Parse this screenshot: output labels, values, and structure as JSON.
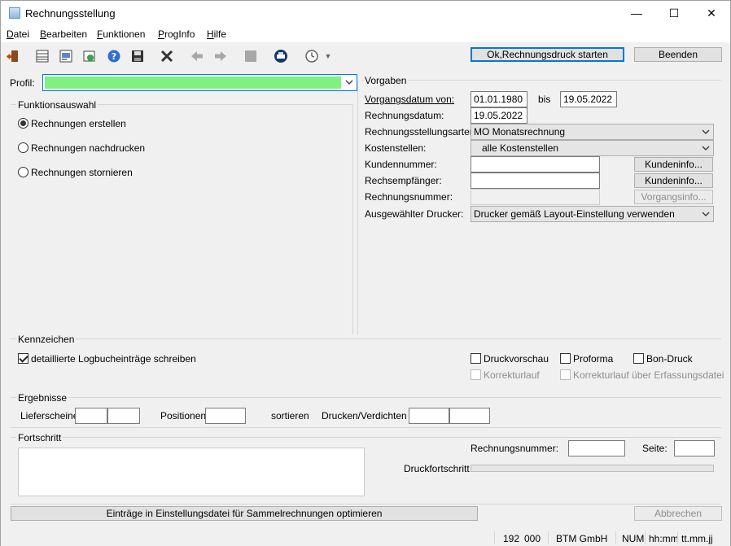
{
  "window": {
    "title": "Rechnungsstellung",
    "controls": {
      "minimize": "—",
      "maximize": "☐",
      "close": "✕"
    }
  },
  "menu": [
    {
      "u": "D",
      "rest": "atei"
    },
    {
      "u": "B",
      "rest": "earbeiten"
    },
    {
      "u": "F",
      "rest": "unktionen"
    },
    {
      "u": "P",
      "rest": "rogInfo"
    },
    {
      "u": "H",
      "rest": "ilfe"
    }
  ],
  "toolbar": {
    "start_button": "Ok,Rechnungsdruck starten",
    "exit_button": "Beenden"
  },
  "profile": {
    "label": "Profil:",
    "value": ""
  },
  "funktionsauswahl": {
    "title": "Funktionsauswahl",
    "options": [
      {
        "label": "Rechnungen erstellen",
        "checked": true
      },
      {
        "label": "Rechnungen nachdrucken",
        "checked": false
      },
      {
        "label": "Rechnungen stornieren",
        "checked": false
      }
    ]
  },
  "vorgaben": {
    "title": "Vorgaben",
    "vorgangsdatum_label": "Vorgangsdatum von:",
    "vorgangsdatum_from": "01.01.1980",
    "bis_label": "bis",
    "vorgangsdatum_to": "19.05.2022",
    "rechnungsdatum_label": "Rechnungsdatum:",
    "rechnungsdatum": "19.05.2022",
    "arten_label": "Rechnungsstellungsarten:",
    "arten_value": "MO Monatsrechnung",
    "kostenstellen_label": "Kostenstellen:",
    "kostenstellen_value": "alle Kostenstellen",
    "kundennummer_label": "Kundennummer:",
    "kundennummer": "",
    "kundeninfo_button": "Kundeninfo...",
    "rechempf_label": "Rechsempfänger:",
    "rechempf": "",
    "kundeninfo2_button": "Kundeninfo...",
    "rechnungsnummer_label": "Rechnungsnummer:",
    "rechnungsnummer": "",
    "vorgangsinfo_button": "Vorgangsinfo...",
    "drucker_label": "Ausgewählter Drucker:",
    "drucker_value": "Drucker gemäß Layout-Einstellung verwenden"
  },
  "kennzeichen": {
    "title": "Kennzeichen",
    "logbuch": "detaillierte Logbucheinträge schreiben",
    "druckvorschau": "Druckvorschau",
    "proforma": "Proforma",
    "bondruck": "Bon-Druck",
    "korrekturlauf": "Korrekturlauf",
    "korrektur_erfassung": "Korrekturlauf über Erfassungsdatei"
  },
  "ergebnisse": {
    "title": "Ergebnisse",
    "lieferscheine": "Lieferscheine",
    "positionen": "Positionen",
    "sortieren": "sortieren",
    "drucken": "Drucken/Verdichten"
  },
  "fortschritt": {
    "title": "Fortschritt",
    "rechnungsnummer_label": "Rechnungsnummer:",
    "seite_label": "Seite:",
    "druckfortschritt_label": "Druckfortschritt",
    "progress": 0
  },
  "optimize_button": "Einträge in Einstellungsdatei für Sammelrechnungen optimieren",
  "abbrechen_button": "Abbrechen",
  "status": {
    "num1": "192",
    "num2": "000",
    "company": "BTM GmbH",
    "numlock": "NUM",
    "time": "hh:mm",
    "date": "tt.mm.jj"
  },
  "colors": {
    "accent": "#0078d7",
    "profile_fill": "#80f080"
  }
}
